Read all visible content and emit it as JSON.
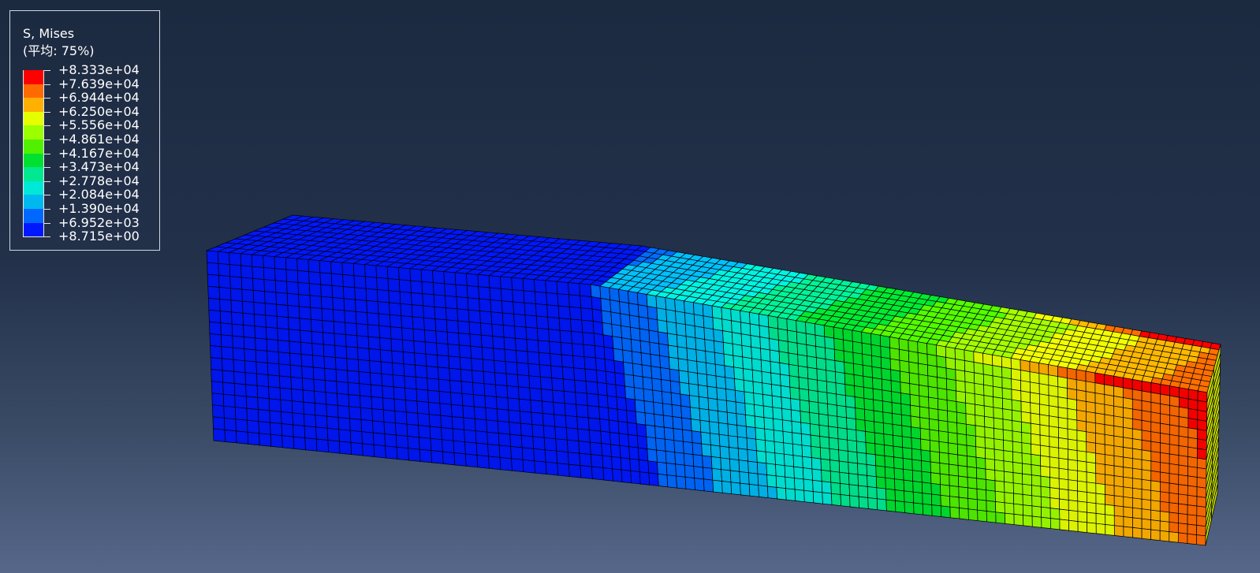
{
  "legend": {
    "title": "S, Mises",
    "subtitle": "(平均: 75%)",
    "values": [
      "+8.333e+04",
      "+7.639e+04",
      "+6.944e+04",
      "+6.250e+04",
      "+5.556e+04",
      "+4.861e+04",
      "+4.167e+04",
      "+3.473e+04",
      "+2.778e+04",
      "+2.084e+04",
      "+1.390e+04",
      "+6.952e+03",
      "+8.715e+00"
    ],
    "colors": [
      "#ff0000",
      "#ff6a00",
      "#ffb000",
      "#e6ff00",
      "#9cff00",
      "#50f000",
      "#00e030",
      "#00e890",
      "#00e8d8",
      "#00b8f0",
      "#0068ff",
      "#0018ff"
    ]
  },
  "colors": {
    "mesh_line": "#000000",
    "background_top": "#1c2a40",
    "background_bottom": "#56678a"
  }
}
